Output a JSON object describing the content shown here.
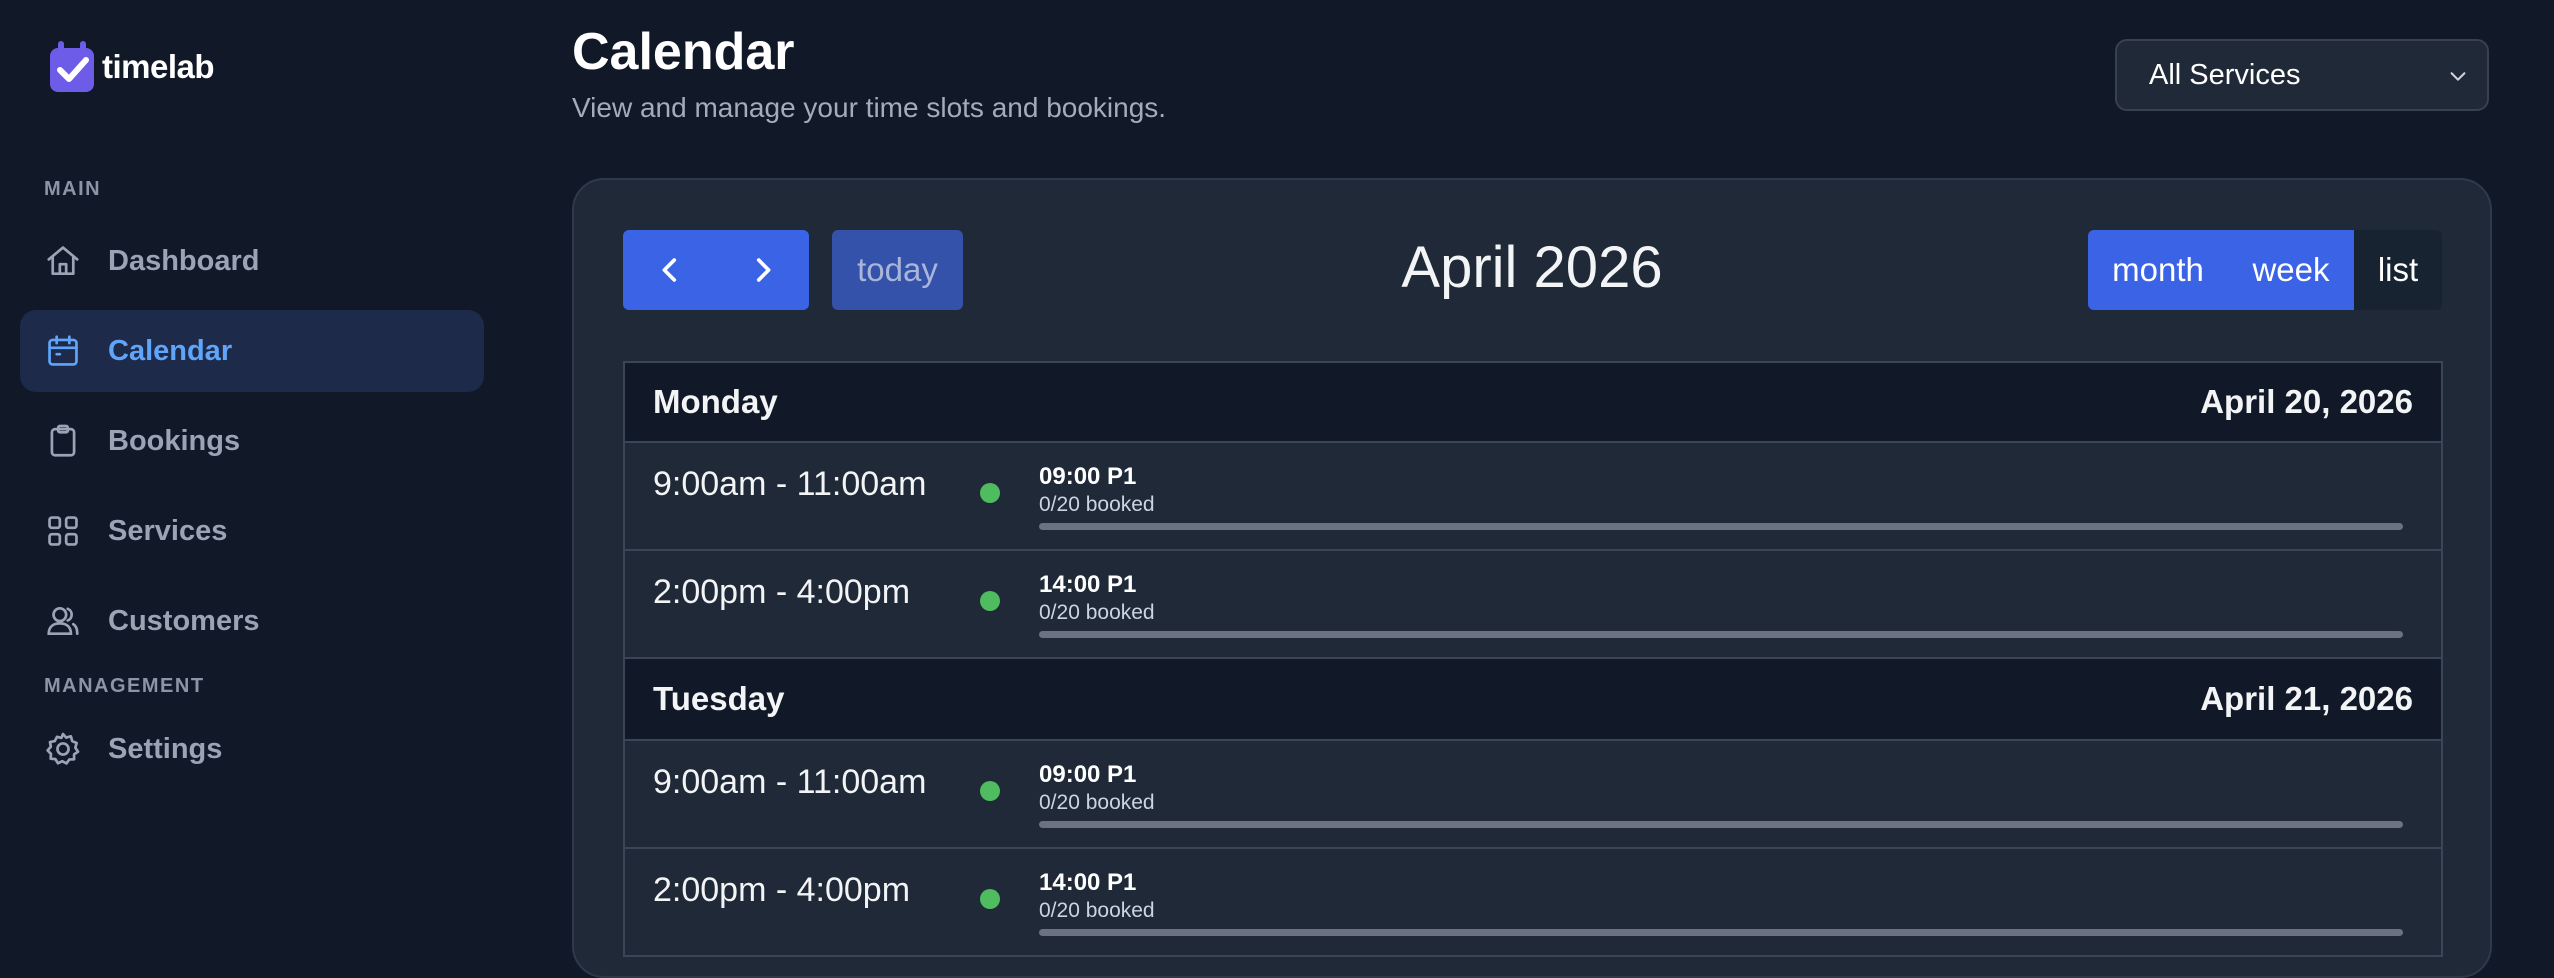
{
  "brand": {
    "name": "timelab",
    "accent": "#6366f1"
  },
  "sidebar": {
    "section_main": "MAIN",
    "section_management": "MANAGEMENT",
    "items": [
      {
        "label": "Dashboard",
        "icon": "home-icon",
        "active": false
      },
      {
        "label": "Calendar",
        "icon": "calendar-icon",
        "active": true
      },
      {
        "label": "Bookings",
        "icon": "clipboard-icon",
        "active": false
      },
      {
        "label": "Services",
        "icon": "grid-icon",
        "active": false
      },
      {
        "label": "Customers",
        "icon": "users-icon",
        "active": false
      },
      {
        "label": "Settings",
        "icon": "gear-icon",
        "active": false
      }
    ]
  },
  "header": {
    "title": "Calendar",
    "subtitle": "View and manage your time slots and bookings.",
    "service_filter": {
      "selected": "All Services"
    }
  },
  "calendar": {
    "today_label": "today",
    "period_title": "April 2026",
    "views": {
      "month": "month",
      "week": "week",
      "list": "list",
      "active": "list"
    },
    "days": [
      {
        "name": "Monday",
        "date": "April 20, 2026",
        "slots": [
          {
            "time": "9:00am - 11:00am",
            "title": "09:00 P1",
            "booked": "0/20 booked",
            "fill": 0
          },
          {
            "time": "2:00pm - 4:00pm",
            "title": "14:00 P1",
            "booked": "0/20 booked",
            "fill": 0
          }
        ]
      },
      {
        "name": "Tuesday",
        "date": "April 21, 2026",
        "slots": [
          {
            "time": "9:00am - 11:00am",
            "title": "09:00 P1",
            "booked": "0/20 booked",
            "fill": 0
          },
          {
            "time": "2:00pm - 4:00pm",
            "title": "14:00 P1",
            "booked": "0/20 booked",
            "fill": 0
          }
        ]
      }
    ]
  },
  "colors": {
    "background": "#111827",
    "card": "#1f2937",
    "primary_button": "#3b63e6",
    "active_nav_text": "#60a5fa",
    "slot_dot": "#4ebc5f"
  }
}
